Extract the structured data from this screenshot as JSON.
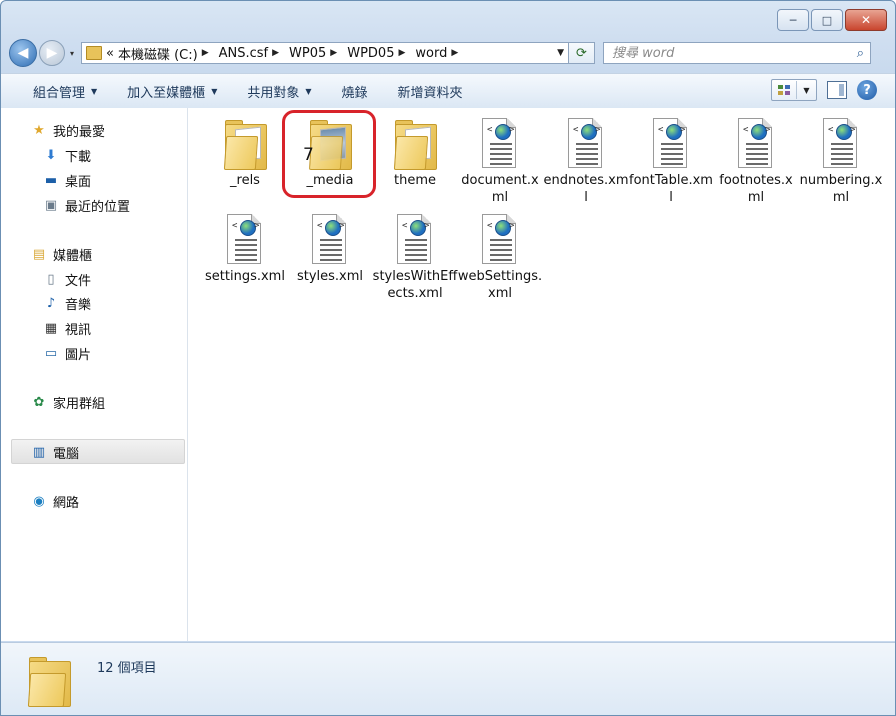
{
  "window": {
    "caption": {
      "minimize": "─",
      "maximize": "□",
      "close": "✕"
    }
  },
  "nav": {
    "back_icon": "◀",
    "forward_icon": "▶",
    "history_caret": "▾",
    "breadcrumb_overflow": "«",
    "breadcrumbs": [
      "本機磁碟 (C:)",
      "ANS.csf",
      "WP05",
      "WPD05",
      "word"
    ],
    "refresh_icon": "⟳",
    "search_placeholder": "搜尋 word",
    "search_icon": "⌕"
  },
  "toolbar": {
    "organize": "組合管理",
    "add_to_library": "加入至媒體櫃",
    "share_with": "共用對象",
    "burn": "燒錄",
    "new_folder": "新增資料夾",
    "help": "?"
  },
  "nav_pane": {
    "favorites": "我的最愛",
    "downloads": "下載",
    "desktop": "桌面",
    "recent": "最近的位置",
    "libraries": "媒體櫃",
    "documents": "文件",
    "music": "音樂",
    "videos": "視訊",
    "pictures": "圖片",
    "homegroup": "家用群組",
    "computer": "電腦",
    "network": "網路"
  },
  "files": [
    {
      "name": "_rels",
      "type": "folder"
    },
    {
      "name": "_media",
      "type": "folder"
    },
    {
      "name": "theme",
      "type": "folder"
    },
    {
      "name": "document.xml",
      "type": "xml"
    },
    {
      "name": "endnotes.xml",
      "type": "xml"
    },
    {
      "name": "fontTable.xml",
      "type": "xml"
    },
    {
      "name": "footnotes.xml",
      "type": "xml"
    },
    {
      "name": "numbering.xml",
      "type": "xml"
    },
    {
      "name": "settings.xml",
      "type": "xml"
    },
    {
      "name": "styles.xml",
      "type": "xml"
    },
    {
      "name": "stylesWithEffects.xml",
      "type": "xml"
    },
    {
      "name": "webSettings.xml",
      "type": "xml"
    }
  ],
  "annotation": {
    "number": "7",
    "highlight_color": "#d8232a"
  },
  "details": {
    "item_count": "12 個項目"
  },
  "colors": {
    "accent": "#1e395b",
    "folder": "#e8c35a"
  }
}
